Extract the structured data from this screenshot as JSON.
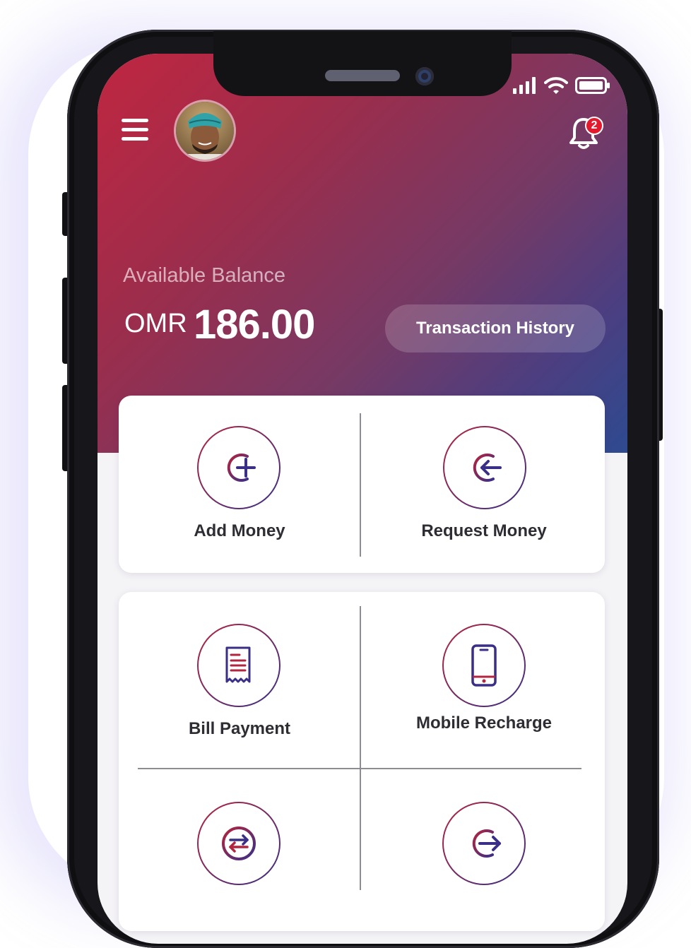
{
  "status_bar": {
    "icons": [
      "signal-icon",
      "wifi-icon",
      "battery-icon"
    ]
  },
  "header": {
    "menu_icon": "hamburger-menu-icon",
    "avatar": "user-avatar",
    "notifications": {
      "icon": "bell-icon",
      "badge_count": "2"
    }
  },
  "balance": {
    "label": "Available Balance",
    "currency": "OMR",
    "amount": "186.00",
    "history_button": "Transaction History"
  },
  "actions": {
    "primary": [
      {
        "label": "Add Money",
        "icon": "add-money-icon"
      },
      {
        "label": "Request Money",
        "icon": "request-money-icon"
      }
    ],
    "services": [
      {
        "label": "Bill Payment",
        "icon": "bill-icon"
      },
      {
        "label": "Mobile Recharge",
        "icon": "mobile-phone-icon"
      },
      {
        "label": "",
        "icon": "transfer-arrows-icon"
      },
      {
        "label": "",
        "icon": "send-money-icon"
      }
    ]
  },
  "colors": {
    "gradient_start": "#c02640",
    "gradient_end": "#2e4a90",
    "badge": "#e3192d",
    "icon_red": "#b3253f",
    "icon_indigo": "#3a2f86"
  }
}
